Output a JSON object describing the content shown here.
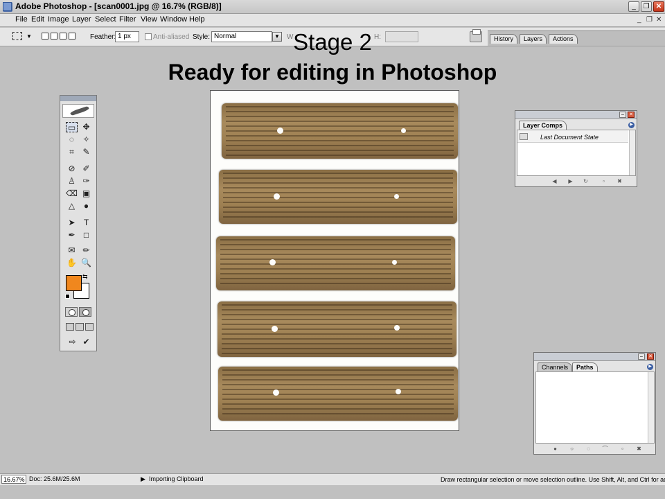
{
  "window": {
    "title": "Adobe Photoshop - [scan0001.jpg @ 16.7% (RGB/8)]",
    "controls": {
      "minimize": "_",
      "restore": "❐",
      "close": "✕"
    }
  },
  "menu": {
    "items": [
      "File",
      "Edit",
      "Image",
      "Layer",
      "Select",
      "Filter",
      "View",
      "Window",
      "Help"
    ],
    "doc_controls": {
      "minimize": "_",
      "restore": "❐",
      "close": "✕"
    }
  },
  "options": {
    "feather_label": "Feather:",
    "feather_value": "1 px",
    "antialiased_label": "Anti-aliased",
    "style_label": "Style:",
    "style_value": "Normal",
    "width_label_partial": "W",
    "height_label_partial": "H:"
  },
  "palette_well": {
    "tabs": [
      "History",
      "Layers",
      "Actions"
    ]
  },
  "slide": {
    "heading": "Stage 2",
    "subheading": "Ready for editing in Photoshop"
  },
  "toolbox": {
    "tools": [
      "▭",
      "✥",
      "◌",
      "✧",
      "⌗",
      "✎",
      "⊘",
      "✐",
      "♙",
      "✑",
      "⌫",
      "▣",
      "△",
      "●",
      "➤",
      "T",
      "✒",
      "□",
      "✉",
      "✏",
      "✋",
      "🔍"
    ],
    "swap_glyph": "⇆",
    "foreground_color": "#f0871e",
    "background_color": "#ffffff"
  },
  "layer_comps_panel": {
    "tab": "Layer Comps",
    "item": "Last Document State"
  },
  "paths_panel": {
    "tabs": [
      "Channels",
      "Paths"
    ],
    "active_tab": "Paths"
  },
  "status": {
    "zoom": "16.67%",
    "doc_size": "Doc: 25.6M/25.6M",
    "progress": "Importing Clipboard",
    "hint": "Draw rectangular selection or move selection outline.  Use Shift, Alt, and Ctrl for additional options."
  }
}
